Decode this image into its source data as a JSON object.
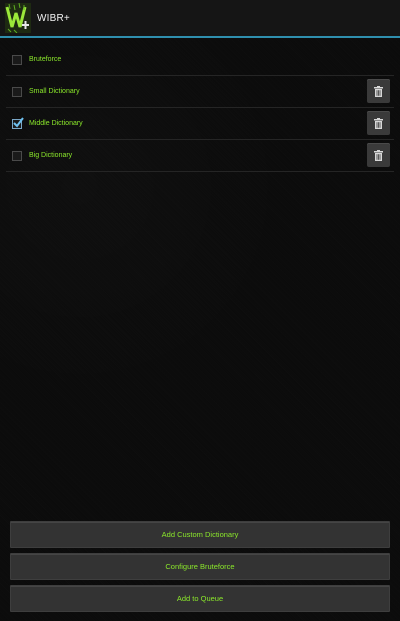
{
  "app": {
    "title": "WIBR+",
    "icon": "wibr-logo-icon",
    "accent_color": "#2f8fae",
    "label_color": "#8be82b"
  },
  "options": [
    {
      "label": "Bruteforce",
      "checked": false,
      "deletable": false
    },
    {
      "label": "Small Dictionary",
      "checked": false,
      "deletable": true
    },
    {
      "label": "Middle Dictionary",
      "checked": true,
      "deletable": true
    },
    {
      "label": "Big Dictionary",
      "checked": false,
      "deletable": true
    }
  ],
  "buttons": {
    "add_custom_dictionary": "Add Custom Dictionary",
    "configure_bruteforce": "Configure Bruteforce",
    "add_to_queue": "Add to Queue"
  },
  "icons": {
    "delete": "trash-icon",
    "check": "checkmark-icon"
  }
}
